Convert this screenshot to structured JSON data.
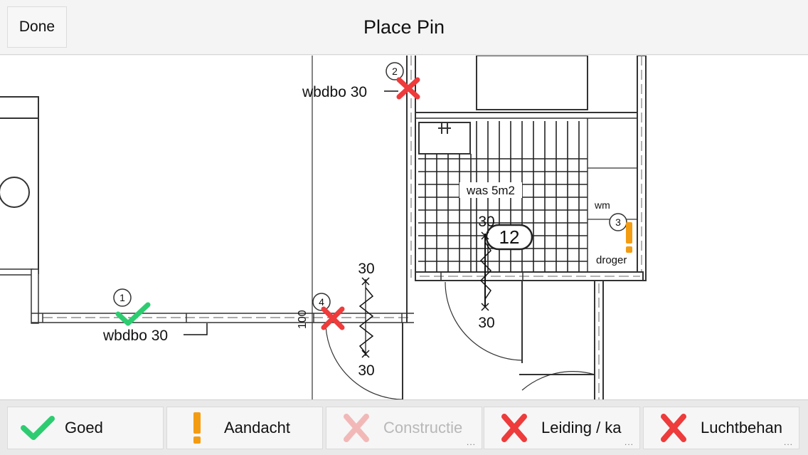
{
  "topbar": {
    "done_label": "Done",
    "title": "Place Pin"
  },
  "plan": {
    "room_label": "was 5m2",
    "room_number": "12",
    "label_wm": "wm",
    "label_droger": "droger",
    "label_wbdbo_top": "wbdbo 30",
    "label_wbdbo_bottom": "wbdbo 30",
    "label_100": "100",
    "dims": {
      "d1": "30",
      "d2": "30",
      "d3": "30",
      "d4": "30"
    },
    "pins": [
      {
        "number": "1",
        "status": "goed"
      },
      {
        "number": "2",
        "status": "leiding"
      },
      {
        "number": "3",
        "status": "aandacht"
      },
      {
        "number": "4",
        "status": "leiding"
      }
    ]
  },
  "toolbar": {
    "buttons": [
      {
        "label": "Goed",
        "icon": "check-icon",
        "enabled": true,
        "more": ""
      },
      {
        "label": "Aandacht",
        "icon": "exclamation-icon",
        "enabled": true,
        "more": ""
      },
      {
        "label": "Constructie",
        "icon": "cross-icon",
        "enabled": false,
        "more": "..."
      },
      {
        "label": "Leiding / ka",
        "icon": "cross-icon",
        "enabled": true,
        "more": "..."
      },
      {
        "label": "Luchtbehan",
        "icon": "cross-icon",
        "enabled": true,
        "more": "..."
      }
    ]
  },
  "colors": {
    "goed": "#2ecc71",
    "aandacht": "#f39c12",
    "cross": "#ee3b3b",
    "cross_disabled": "#f2b8b8"
  }
}
